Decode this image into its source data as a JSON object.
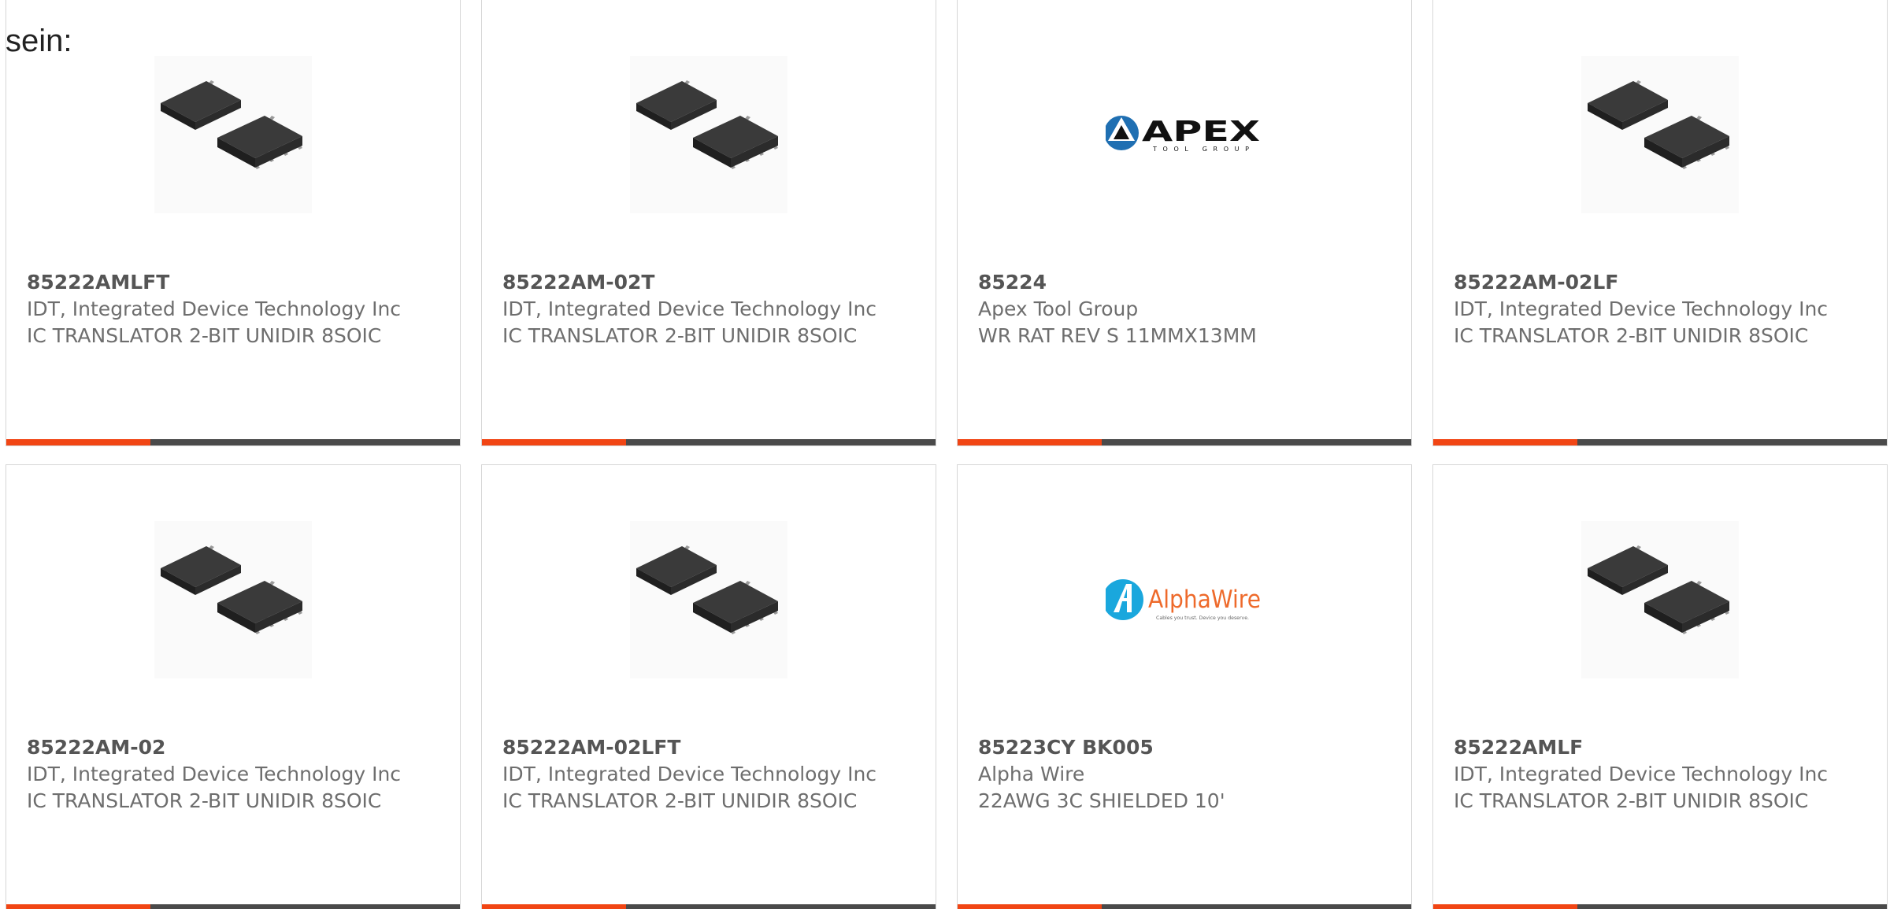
{
  "intro_text": "sein:",
  "colors": {
    "accent": "#f14514",
    "bar": "#4a4a4a",
    "border": "#d6d6d6",
    "text": "#6e6e6e"
  },
  "cards": [
    {
      "part_number": "85222AMLFT",
      "manufacturer": "IDT, Integrated Device Technology Inc",
      "description": "IC TRANSLATOR 2-BIT UNIDIR 8SOIC",
      "image_icon": "ic-chip-icon"
    },
    {
      "part_number": "85222AM-02T",
      "manufacturer": "IDT, Integrated Device Technology Inc",
      "description": "IC TRANSLATOR 2-BIT UNIDIR 8SOIC",
      "image_icon": "ic-chip-icon"
    },
    {
      "part_number": "85224",
      "manufacturer": "Apex Tool Group",
      "description": "WR RAT REV S 11MMX13MM",
      "image_icon": "apex-logo",
      "logo": {
        "name": "APEX",
        "tagline": "TOOL GROUP"
      }
    },
    {
      "part_number": "85222AM-02LF",
      "manufacturer": "IDT, Integrated Device Technology Inc",
      "description": "IC TRANSLATOR 2-BIT UNIDIR 8SOIC",
      "image_icon": "ic-chip-icon"
    },
    {
      "part_number": "85222AM-02",
      "manufacturer": "IDT, Integrated Device Technology Inc",
      "description": "IC TRANSLATOR 2-BIT UNIDIR 8SOIC",
      "image_icon": "ic-chip-icon"
    },
    {
      "part_number": "85222AM-02LFT",
      "manufacturer": "IDT, Integrated Device Technology Inc",
      "description": "IC TRANSLATOR 2-BIT UNIDIR 8SOIC",
      "image_icon": "ic-chip-icon"
    },
    {
      "part_number": "85223CY BK005",
      "manufacturer": "Alpha Wire",
      "description": "22AWG 3C SHIELDED 10'",
      "image_icon": "alphawire-logo",
      "logo": {
        "name": "AlphaWire",
        "tagline": "Cables you trust. Device you deserve."
      }
    },
    {
      "part_number": "85222AMLF",
      "manufacturer": "IDT, Integrated Device Technology Inc",
      "description": "IC TRANSLATOR 2-BIT UNIDIR 8SOIC",
      "image_icon": "ic-chip-icon"
    }
  ]
}
